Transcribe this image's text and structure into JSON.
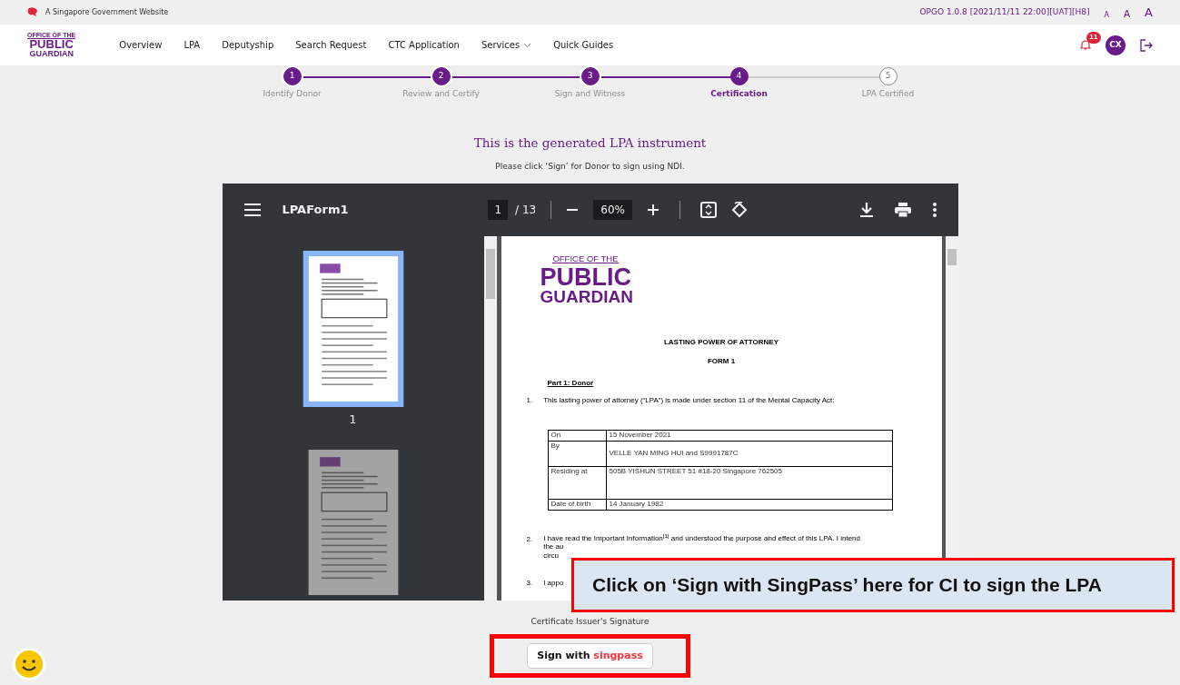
{
  "gov_bar": {
    "text": "A Singapore Government Website",
    "version": "OPGO 1.0.8 [2021/11/11 22:00][UAT][H8]",
    "font_sizes": [
      "A",
      "A",
      "A"
    ]
  },
  "logo": {
    "line1": "OFFICE OF THE",
    "line2": "PUBLIC",
    "line3": "GUARDIAN"
  },
  "nav": [
    {
      "label": "Overview",
      "dropdown": false
    },
    {
      "label": "LPA",
      "dropdown": false
    },
    {
      "label": "Deputyship",
      "dropdown": false
    },
    {
      "label": "Search Request",
      "dropdown": false
    },
    {
      "label": "CTC Application",
      "dropdown": false
    },
    {
      "label": "Services",
      "dropdown": true
    },
    {
      "label": "Quick Guides",
      "dropdown": false
    }
  ],
  "notifications": {
    "count": "11"
  },
  "avatar": {
    "initials": "CX"
  },
  "steps": [
    {
      "number": "1",
      "label": "Identify Donor",
      "done": true,
      "selected": false
    },
    {
      "number": "2",
      "label": "Review and Certify",
      "done": true,
      "selected": false
    },
    {
      "number": "3",
      "label": "Sign and Witness",
      "done": true,
      "selected": false
    },
    {
      "number": "4",
      "label": "Certification",
      "done": false,
      "selected": true
    },
    {
      "number": "5",
      "label": "LPA Certified",
      "done": false,
      "selected": false
    }
  ],
  "heading": "This is the generated LPA instrument",
  "instruction": "Please click ‘Sign’ for Donor to sign using NDI.",
  "viewer": {
    "title": "LPAForm1",
    "page": "1",
    "page_count": "/ 13",
    "zoom": "60%",
    "thumbnails": [
      {
        "label": "1",
        "selected": true
      },
      {
        "selected": false
      }
    ]
  },
  "document": {
    "logo": {
      "line1": "OFFICE OF THE",
      "line2": "PUBLIC",
      "line3": "GUARDIAN"
    },
    "title": "LASTING POWER OF ATTORNEY",
    "form": "FORM 1",
    "part": "Part 1: Donor",
    "item1": {
      "number": "1.",
      "text": "This lasting power of attorney (“LPA”) is made under section 11 of the Mental Capacity Act:"
    },
    "table": [
      {
        "label": "On",
        "value": "15 November 2021"
      },
      {
        "label": "By",
        "value": "VELLE YAN MING HUI     and S9991787C"
      },
      {
        "label": "Residing at",
        "value": "505B YISHUN STREET 51 #18-20  Singapore 762505"
      },
      {
        "label": "Date of birth",
        "value": "14 January 1982"
      }
    ],
    "item2": {
      "number": "2.",
      "lines": [
        "I have read the Important Information$^{[1]}$ and understood the purpose and effect of this LPA. I intend",
        "the au",
        "circu"
      ]
    },
    "item3": {
      "number": "3.",
      "text": "I appo"
    }
  },
  "signature_label": "Certificate Issuer's Signature",
  "sign_button": {
    "prefix": "Sign with",
    "brand": "singpass"
  },
  "callout": "Click on ‘Sign with SingPass’ here for CI to sign the LPA"
}
